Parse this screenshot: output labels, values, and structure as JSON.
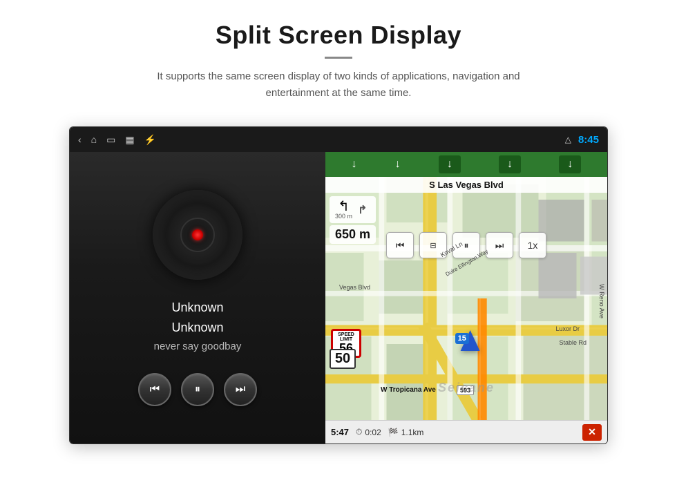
{
  "header": {
    "title": "Split Screen Display",
    "divider": true,
    "subtitle": "It supports the same screen display of two kinds of applications, navigation and entertainment at the same time."
  },
  "status_bar": {
    "time": "8:45",
    "nav_icons": [
      "‹",
      "⌂",
      "▭",
      "🖼",
      "⚡"
    ],
    "triangle_icon": "△"
  },
  "music_panel": {
    "track_title": "Unknown",
    "artist": "Unknown",
    "song": "never say goodbay",
    "controls": {
      "prev_label": "⏮",
      "play_pause_label": "⏸",
      "next_label": "⏭"
    }
  },
  "nav_panel": {
    "direction_arrows": [
      "↓",
      "↓",
      "↓",
      "↓",
      "↓"
    ],
    "street_name": "S Las Vegas Blvd",
    "turn_instruction": {
      "icon": "↰",
      "distance": "300 m",
      "secondary": "650 m"
    },
    "media_controls": {
      "prev": "⏮",
      "chapters": "⊟",
      "pause": "⏸",
      "next": "⏭",
      "speed": "1x"
    },
    "speed_limit": {
      "label": "SPEED\nLIMIT",
      "value": "56"
    },
    "speed_50": "50",
    "bottom_bar": {
      "time": "5:47",
      "eta_icon": "⏱",
      "eta": "0:02",
      "dist_icon": "📍",
      "dist": "1.1km",
      "close": "✕"
    },
    "road_labels": [
      "Koval Ln",
      "Duke Ellington Way",
      "Vegas Blvd",
      "Luxor Dr",
      "Stable Rd",
      "W Tropicana Ave",
      "W Reno Ave"
    ]
  },
  "watermark": "Seicane"
}
